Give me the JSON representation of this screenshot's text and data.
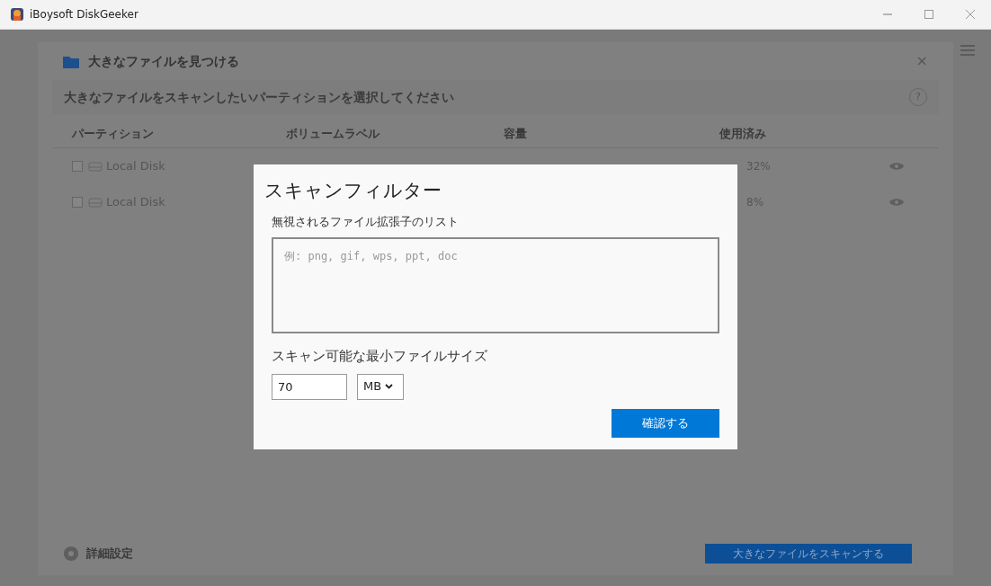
{
  "window": {
    "title": "iBoysoft DiskGeeker"
  },
  "panel": {
    "title": "大きなファイルを見つける",
    "instruction": "大きなファイルをスキャンしたいパーティションを選択してください",
    "help": "?",
    "close": "×"
  },
  "table": {
    "columns": [
      "パーティション",
      "ボリュームラベル",
      "容量",
      "使用済み"
    ],
    "rows": [
      {
        "name": "Local Disk",
        "checked": false,
        "used": "32%"
      },
      {
        "name": "Local Disk",
        "checked": false,
        "used": "8%"
      }
    ]
  },
  "footer": {
    "settings": "詳細設定",
    "scan_button": "大きなファイルをスキャンする"
  },
  "dialog": {
    "title": "スキャンフィルター",
    "ext_label": "無視されるファイル拡張子のリスト",
    "ext_placeholder": "例: png, gif, wps, ppt, doc",
    "size_label": "スキャン可能な最小ファイルサイズ",
    "size_value": "70",
    "unit": "MB",
    "confirm": "確認する"
  }
}
